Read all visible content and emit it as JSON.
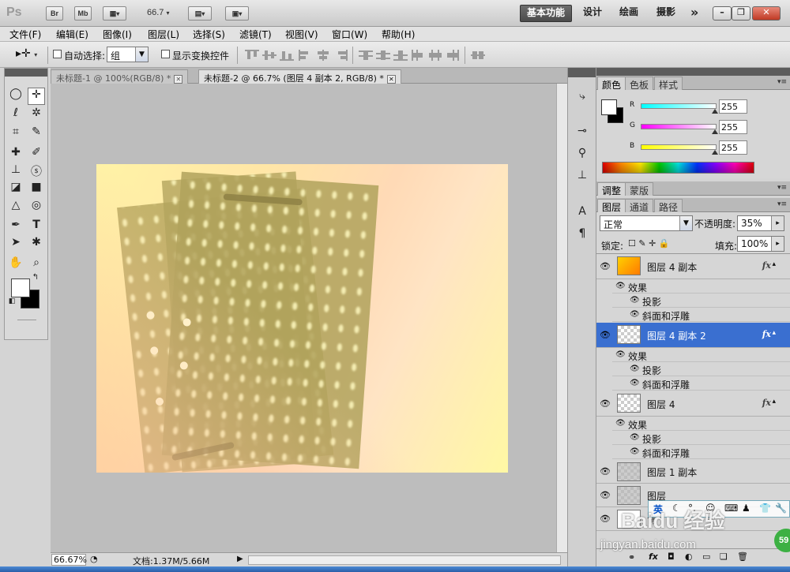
{
  "app": {
    "logo": "Ps",
    "bridge_btn": "Br",
    "minibridge_btn": "Mb",
    "zoom": "66.7",
    "workspaces": [
      "基本功能",
      "设计",
      "绘画",
      "摄影"
    ],
    "more": "»"
  },
  "menu": [
    "文件(F)",
    "编辑(E)",
    "图像(I)",
    "图层(L)",
    "选择(S)",
    "滤镜(T)",
    "视图(V)",
    "窗口(W)",
    "帮助(H)"
  ],
  "options": {
    "auto_select_label": "自动选择:",
    "auto_select_value": "组",
    "show_transform_label": "显示变换控件"
  },
  "tabs": [
    {
      "label": "未标题-1 @ 100%(RGB/8) *"
    },
    {
      "label": "未标题-2 @ 66.7% (图层 4 副本 2, RGB/8) *"
    }
  ],
  "status": {
    "zoom": "66.67%",
    "doc": "文档:1.37M/5.66M"
  },
  "color_panel": {
    "tabs": [
      "颜色",
      "色板",
      "样式"
    ],
    "channels": [
      {
        "label": "R",
        "value": "255"
      },
      {
        "label": "G",
        "value": "255"
      },
      {
        "label": "B",
        "value": "255"
      }
    ]
  },
  "adjust_panel": {
    "tabs": [
      "调整",
      "蒙版"
    ]
  },
  "layers_panel": {
    "tabs": [
      "图层",
      "通道",
      "路径"
    ],
    "blend_mode": "正常",
    "opacity_label": "不透明度:",
    "opacity": "35%",
    "lock_label": "锁定:",
    "fill_label": "填充:",
    "fill": "100%",
    "layers": [
      {
        "name": "图层 4 副本",
        "fx": "fx",
        "effects_label": "效果",
        "effects": [
          "投影",
          "斜面和浮雕"
        ]
      },
      {
        "name": "图层 4 副本 2",
        "fx": "fx",
        "effects_label": "效果",
        "effects": [
          "投影",
          "斜面和浮雕"
        ]
      },
      {
        "name": "图层 4",
        "fx": "fx",
        "effects_label": "效果",
        "effects": [
          "投影",
          "斜面和浮雕"
        ]
      },
      {
        "name": "图层 1 副本"
      },
      {
        "name": "图层"
      },
      {
        "name": "背"
      }
    ]
  },
  "overlay": {
    "ime": "英",
    "watermark": "Baidu 经验",
    "url": "jingyan.baidu.com",
    "badge": "59"
  },
  "colors": {
    "selected_row": "#3a6fd0",
    "watermark_green": "#3cb043"
  }
}
